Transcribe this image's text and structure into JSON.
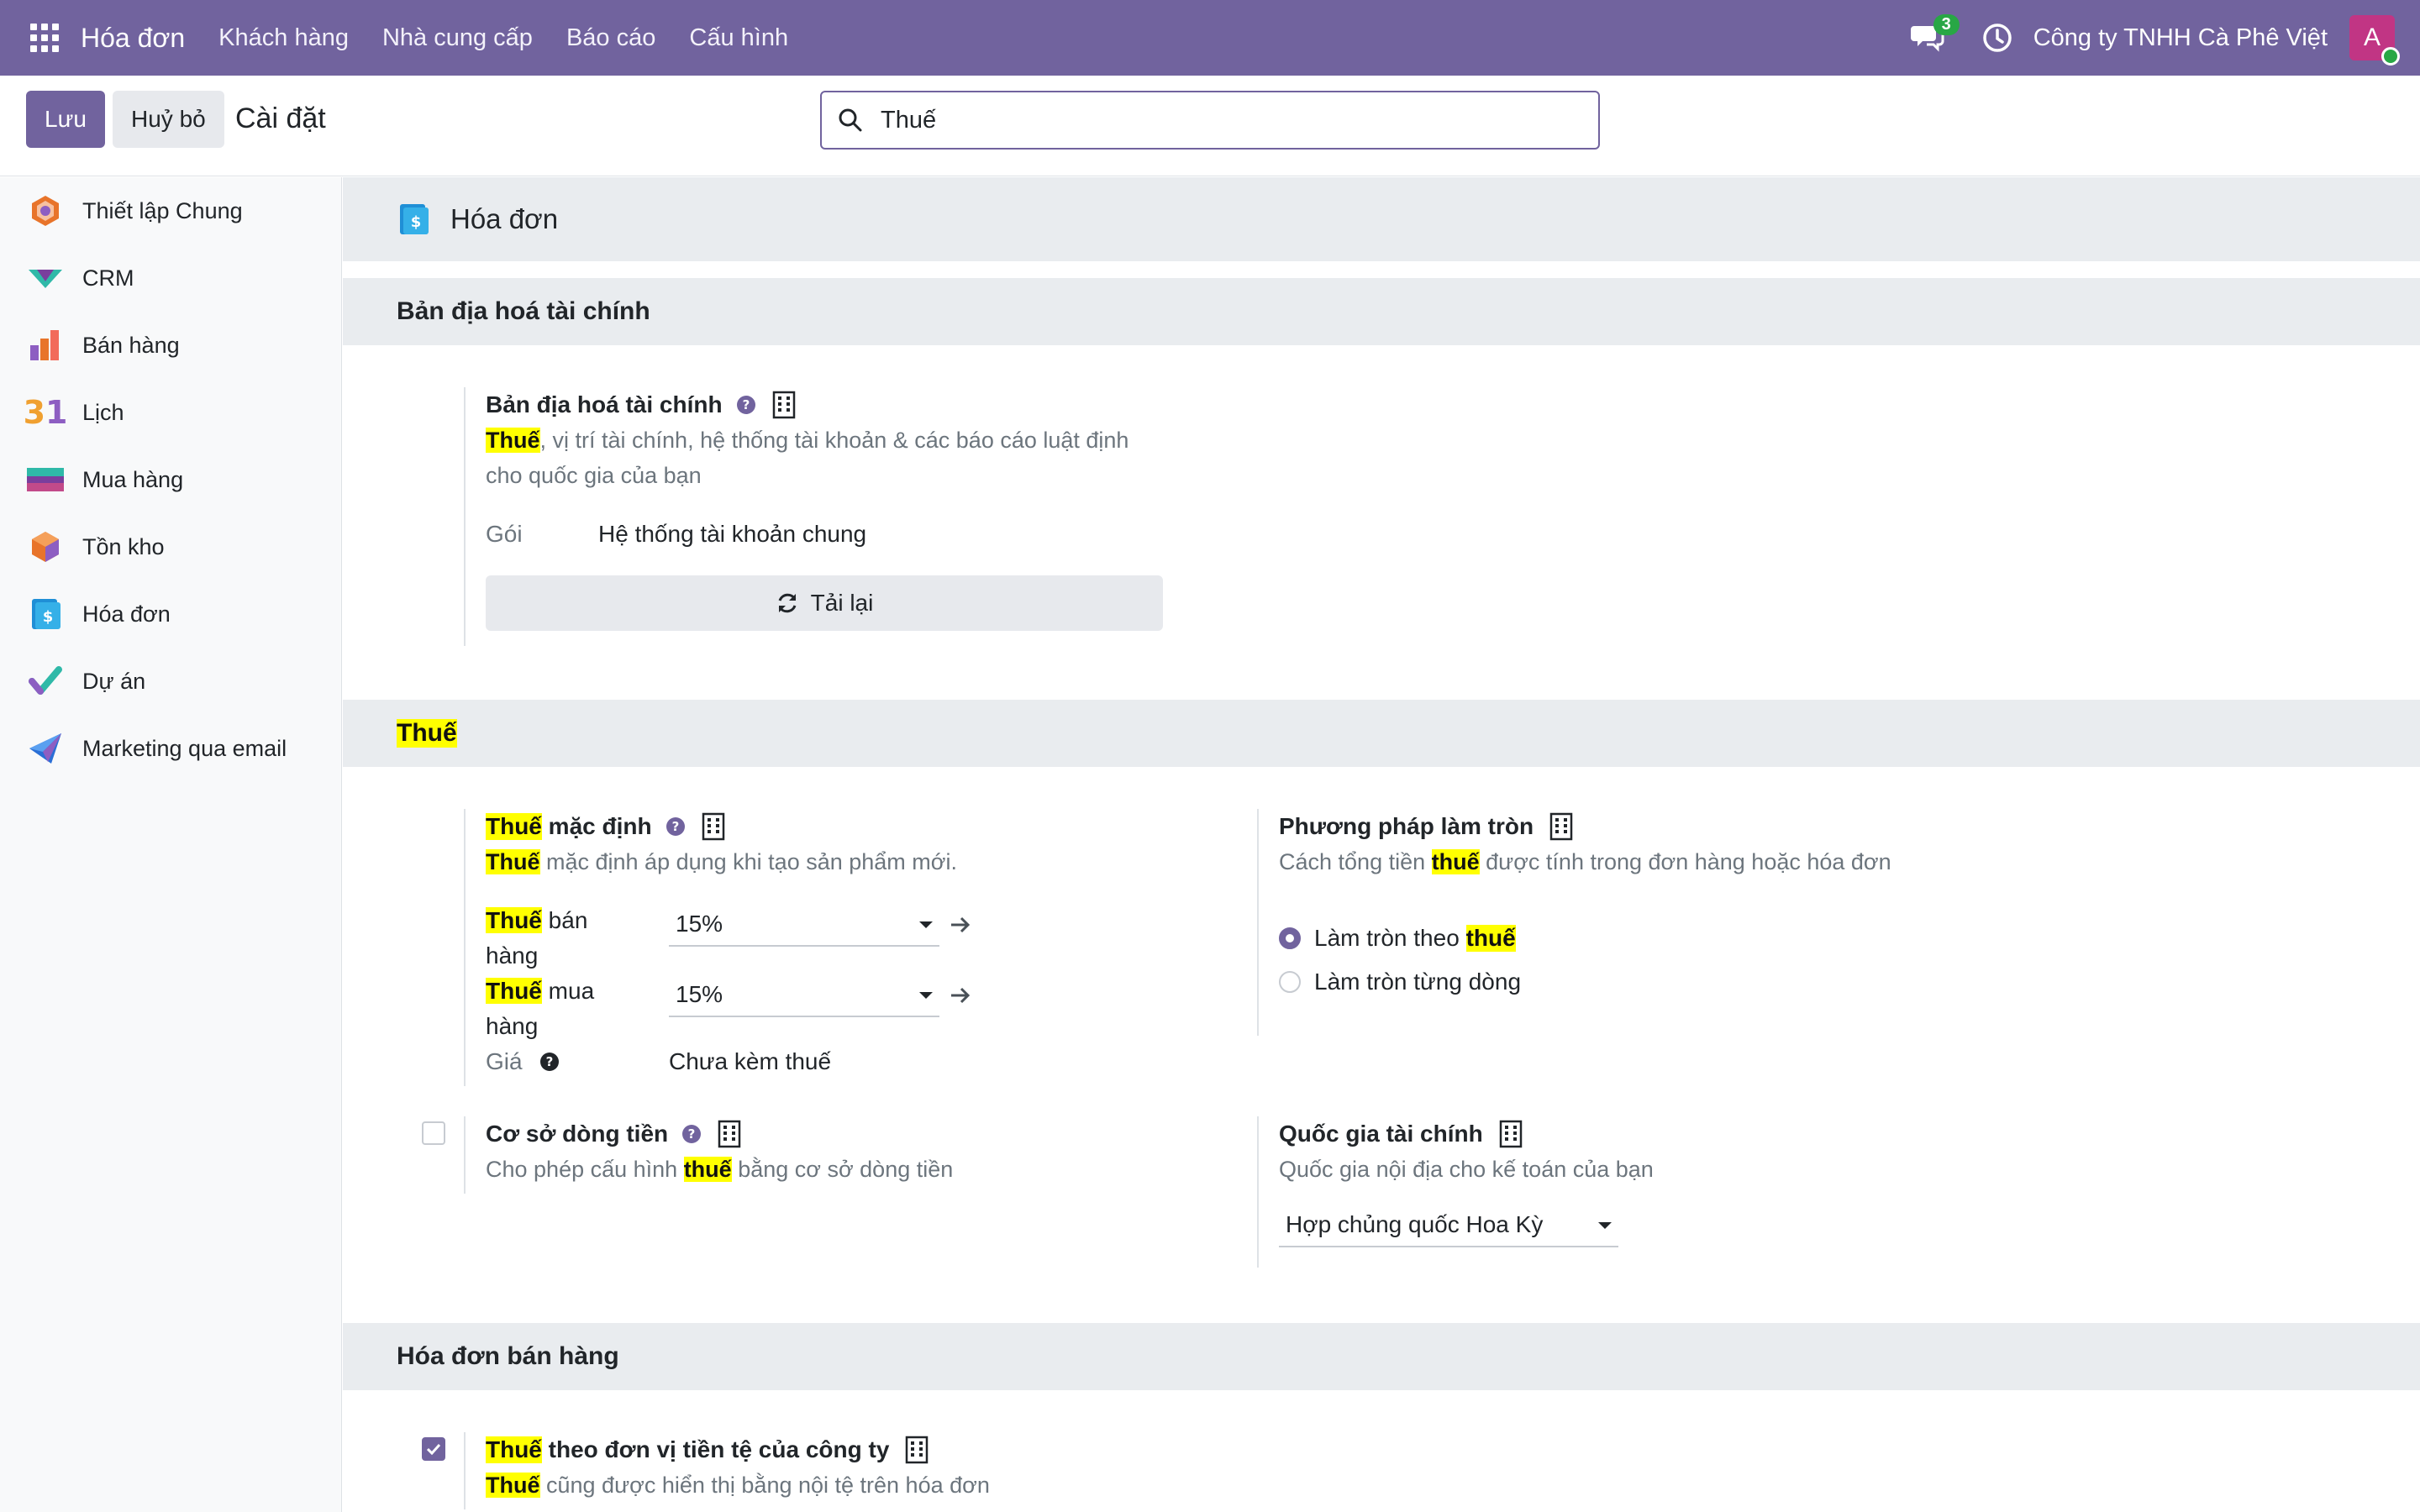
{
  "topbar": {
    "brand": "Hóa đơn",
    "menu": [
      "Khách hàng",
      "Nhà cung cấp",
      "Báo cáo",
      "Cấu hình"
    ],
    "chat_count": "3",
    "company": "Công ty TNHH Cà Phê Việt",
    "avatar_letter": "A",
    "colors": {
      "bar": "#71639e",
      "badge": "#28a745",
      "avatar": "#c13584"
    }
  },
  "control": {
    "save": "Lưu",
    "discard": "Huỷ bỏ",
    "title": "Cài đặt",
    "search_value": "Thuế"
  },
  "sidebar": {
    "items": [
      {
        "label": "Thiết lập Chung",
        "icon": "general-settings-icon"
      },
      {
        "label": "CRM",
        "icon": "crm-icon"
      },
      {
        "label": "Bán hàng",
        "icon": "sales-icon"
      },
      {
        "label": "Lịch",
        "icon": "calendar-icon"
      },
      {
        "label": "Mua hàng",
        "icon": "purchase-icon"
      },
      {
        "label": "Tồn kho",
        "icon": "inventory-icon"
      },
      {
        "label": "Hóa đơn",
        "icon": "invoicing-icon"
      },
      {
        "label": "Dự án",
        "icon": "project-icon"
      },
      {
        "label": "Marketing qua email",
        "icon": "email-marketing-icon"
      }
    ],
    "calendar_num": "31"
  },
  "main": {
    "app_title": "Hóa đơn",
    "fiscal": {
      "section": "Bản địa hoá tài chính",
      "title": "Bản địa hoá tài chính",
      "desc_hl": "Thuế",
      "desc_rest": ", vị trí tài chính, hệ thống tài khoản & các báo cáo luật định cho quốc gia của bạn",
      "package_label": "Gói",
      "package_value": "Hệ thống tài khoản chung",
      "reload": "Tải lại"
    },
    "taxes": {
      "section": "Thuế",
      "default": {
        "title_hl": "Thuế",
        "title_rest": " mặc định",
        "desc_hl": "Thuế",
        "desc_rest": " mặc định áp dụng khi tạo sản phẩm mới.",
        "sales_hl": "Thuế",
        "sales_rest": " bán",
        "sales_rest2": "hàng",
        "sales_value": "15%",
        "purchase_hl": "Thuế",
        "purchase_rest": " mua",
        "purchase_rest2": "hàng",
        "purchase_value": "15%",
        "price_label": "Giá",
        "price_value": "Chưa kèm thuế"
      },
      "rounding": {
        "title": "Phương pháp làm tròn",
        "desc_pre": "Cách tổng tiền ",
        "desc_hl": "thuế",
        "desc_post": " được tính trong đơn hàng hoặc hóa đơn",
        "opt1_pre": "Làm tròn theo ",
        "opt1_hl": "thuế",
        "opt2": "Làm tròn từng dòng",
        "selected": 1
      },
      "cash_basis": {
        "title": "Cơ sở dòng tiền",
        "desc_pre": "Cho phép cấu hình ",
        "desc_hl": "thuế",
        "desc_post": " bằng cơ sở dòng tiền",
        "checked": false
      },
      "fiscal_country": {
        "title": "Quốc gia tài chính",
        "desc": "Quốc gia nội địa cho kế toán của bạn",
        "value": "Hợp chủng quốc Hoa Kỳ"
      }
    },
    "customer_invoices": {
      "section": "Hóa đơn bán hàng",
      "tax_currency": {
        "title_hl": "Thuế",
        "title_rest": " theo đơn vị tiền tệ của công ty",
        "desc_hl": "Thuế",
        "desc_rest": " cũng được hiển thị bằng nội tệ trên hóa đơn",
        "checked": true
      }
    }
  }
}
